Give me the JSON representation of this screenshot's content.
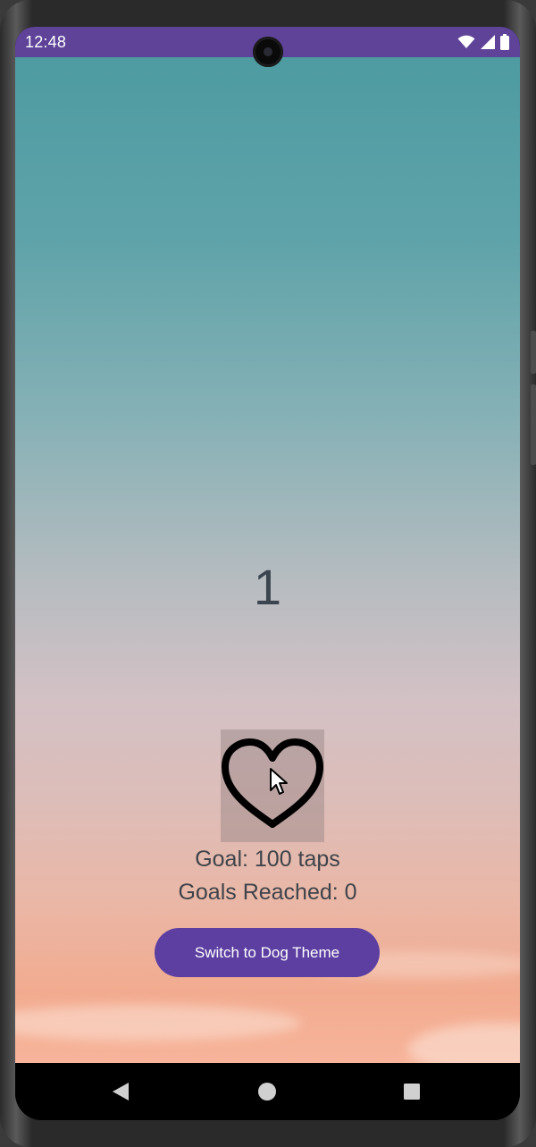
{
  "status_bar": {
    "time": "12:48",
    "icons": [
      "wifi-icon",
      "signal-icon",
      "battery-icon"
    ],
    "background": "#5e4399"
  },
  "main": {
    "counter": "1",
    "heart_icon": "heart-outline-icon",
    "goal_text": "Goal: 100 taps",
    "goals_reached_text": "Goals Reached: 0",
    "theme_button_label": "Switch to Dog Theme",
    "theme_button_color": "#5d3fa1"
  },
  "nav_bar": {
    "items": [
      "back-icon",
      "home-icon",
      "recents-icon"
    ]
  }
}
